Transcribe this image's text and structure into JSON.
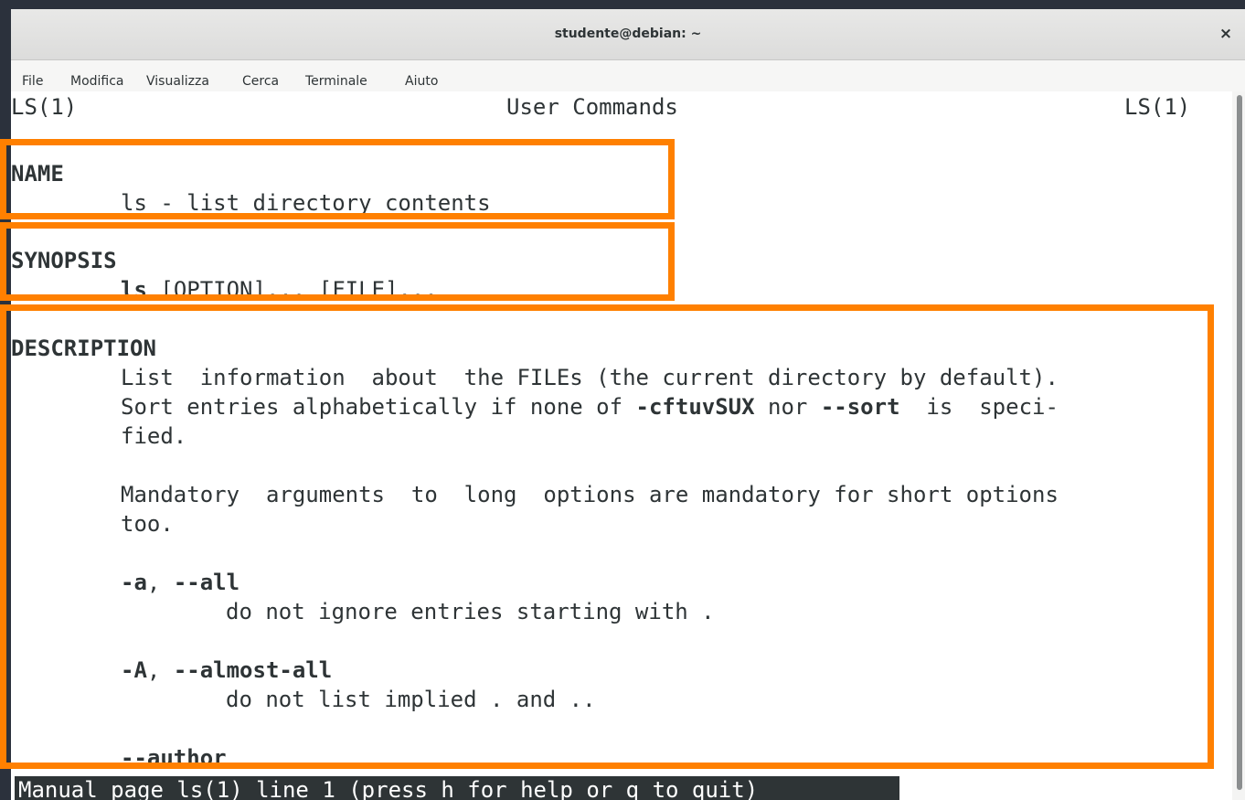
{
  "window": {
    "title": "studente@debian: ~",
    "close_label": "×"
  },
  "menubar": {
    "items": [
      "File",
      "Modifica",
      "Visualizza",
      "Cerca",
      "Terminale",
      "Aiuto"
    ]
  },
  "man": {
    "header_left": "LS(1)",
    "header_center": "User Commands",
    "header_right": "LS(1)",
    "name_heading": "NAME",
    "name_text": "ls - list directory contents",
    "synopsis_heading": "SYNOPSIS",
    "synopsis_cmd": "ls",
    "synopsis_open1": "[",
    "synopsis_option": "OPTION",
    "synopsis_close1": "]... ",
    "synopsis_open2": "[",
    "synopsis_file": "FILE",
    "synopsis_close2": "]...",
    "description_heading": "DESCRIPTION",
    "desc_line1": "List  information  about  the FILEs (the current directory by default).",
    "desc_line2_a": "Sort entries alphabetically if none of ",
    "desc_line2_b": "-cftuvSUX",
    "desc_line2_c": " nor ",
    "desc_line2_d": "--sort",
    "desc_line2_e": "  is  speci-",
    "desc_line3": "fied.",
    "desc_line4": "Mandatory  arguments  to  long  options are mandatory for short options",
    "desc_line5": "too.",
    "opt_a_short": "-a",
    "opt_a_sep": ", ",
    "opt_a_long": "--all",
    "opt_a_desc": "do not ignore entries starting with .",
    "opt_A_short": "-A",
    "opt_A_sep": ", ",
    "opt_A_long": "--almost-all",
    "opt_A_desc": "do not list implied . and ..",
    "opt_author": "--author"
  },
  "statusline": "Manual page ls(1) line 1 (press h for help or q to quit)",
  "colors": {
    "highlight": "#ff8000",
    "terminal_fg": "#2e3436",
    "terminal_bg": "#ffffff"
  }
}
